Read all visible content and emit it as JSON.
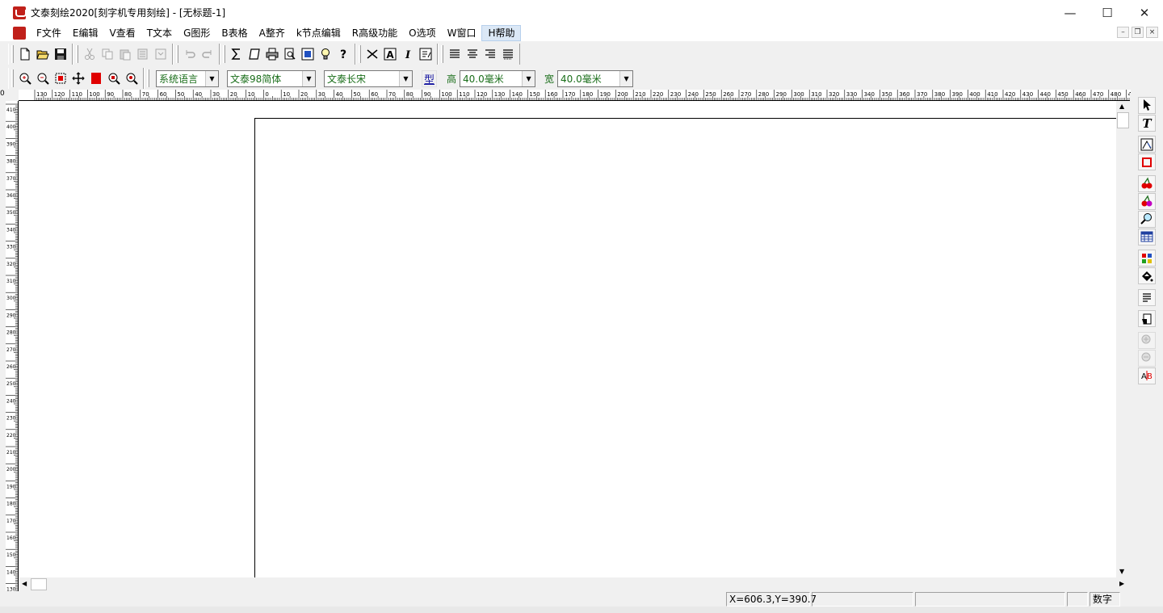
{
  "window": {
    "title": "文泰刻绘2020[刻字机专用刻绘] - [无标题-1]",
    "controls": {
      "minimize": "—",
      "maximize": "☐",
      "close": "✕"
    }
  },
  "menu": {
    "items": [
      {
        "label": "F文件"
      },
      {
        "label": "E编辑"
      },
      {
        "label": "V查看"
      },
      {
        "label": "T文本"
      },
      {
        "label": "G图形"
      },
      {
        "label": "B表格"
      },
      {
        "label": "A整齐"
      },
      {
        "label": "k节点编辑"
      },
      {
        "label": "R高级功能"
      },
      {
        "label": "O选项"
      },
      {
        "label": "W窗口"
      },
      {
        "label": "H帮助"
      }
    ],
    "mdi": {
      "minimize": "–",
      "restore": "❐",
      "close": "×"
    }
  },
  "format_bar": {
    "language": "系统语言",
    "font_en": "文泰98简体",
    "font_cn": "文泰长宋",
    "type_button": "型",
    "height_label": "高",
    "height_value": "40.0毫米",
    "width_label": "宽",
    "width_value": "40.0毫米"
  },
  "rulers": {
    "corner": "0",
    "h_labels": [
      "130",
      "120",
      "110",
      "100",
      "90",
      "80",
      "70",
      "60",
      "50",
      "40",
      "30",
      "20",
      "10",
      "0",
      "10",
      "20",
      "30",
      "40",
      "50",
      "60",
      "70",
      "80",
      "90",
      "100",
      "110",
      "120",
      "130",
      "140",
      "150",
      "160",
      "170",
      "180",
      "190",
      "200",
      "210",
      "220",
      "230",
      "240",
      "250",
      "260",
      "270",
      "280",
      "290",
      "300",
      "310",
      "320",
      "330",
      "340",
      "350",
      "360",
      "370",
      "380",
      "390",
      "400",
      "410",
      "420",
      "430",
      "440",
      "450",
      "460",
      "470",
      "480",
      "490",
      "500"
    ],
    "v_labels": [
      "410",
      "400",
      "390",
      "380",
      "370",
      "360",
      "350",
      "340",
      "330",
      "320",
      "310",
      "300",
      "290",
      "280",
      "270",
      "260",
      "250",
      "240",
      "230",
      "220",
      "210",
      "200",
      "190",
      "180",
      "170",
      "160",
      "150",
      "140",
      "130"
    ]
  },
  "status": {
    "coords": "X=606.3,Y=390.7",
    "num": "数字"
  },
  "colors": {
    "accent_red": "#e00000",
    "green_text": "#1a6e1a"
  }
}
